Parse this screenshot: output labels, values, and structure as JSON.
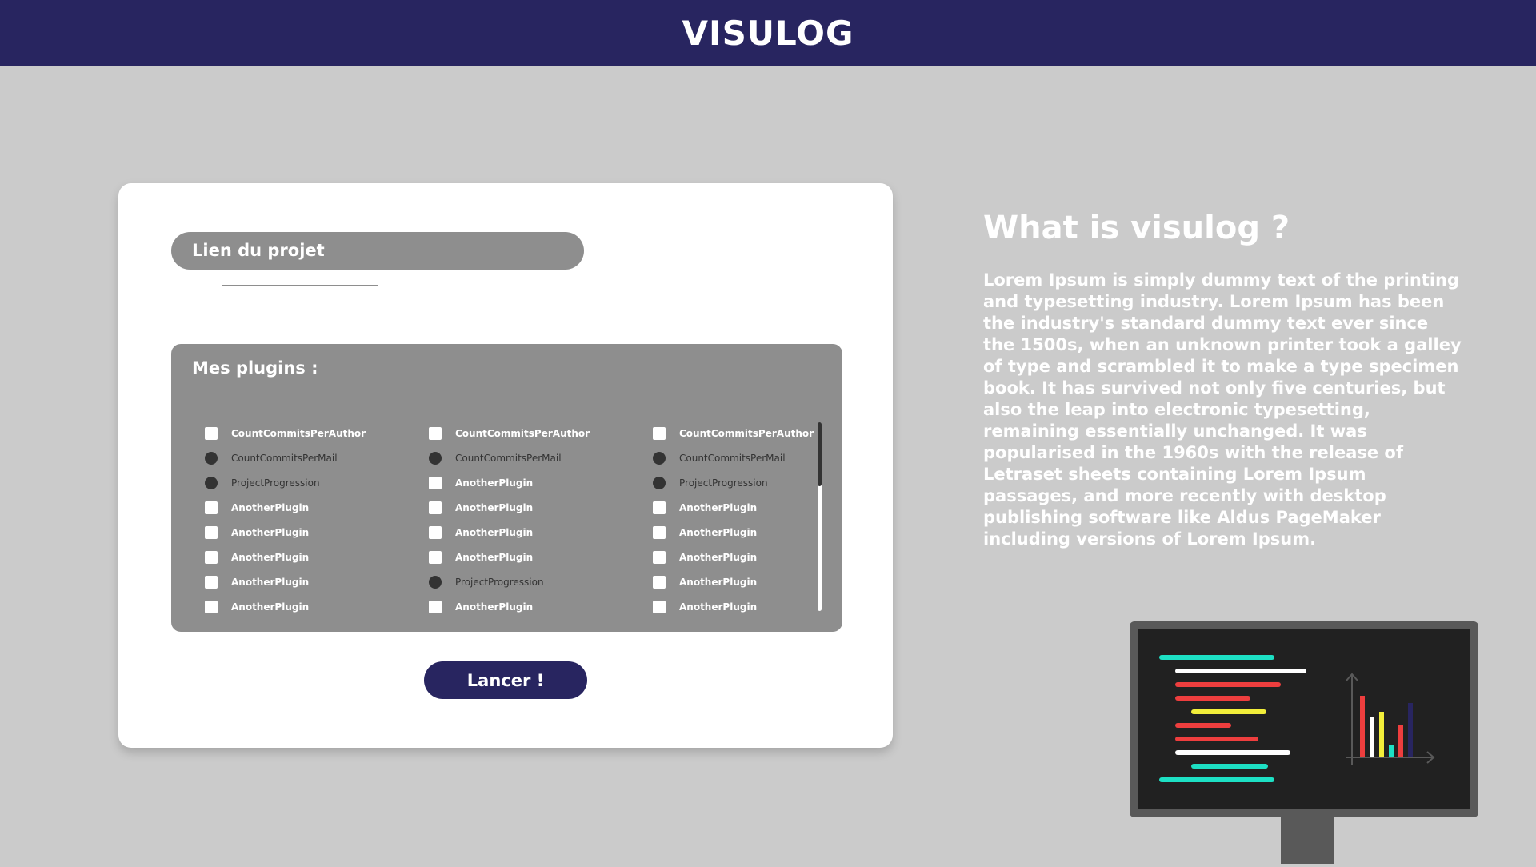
{
  "header": {
    "title": "VISULOG"
  },
  "form": {
    "link_label": "Lien du projet",
    "link_value": "",
    "plugins_title": "Mes plugins :",
    "launch_label": "Lancer !",
    "plugins": [
      [
        {
          "label": "CountCommitsPerAuthor",
          "control": "checkbox"
        },
        {
          "label": "CountCommitsPerMail",
          "control": "radio"
        },
        {
          "label": "ProjectProgression",
          "control": "radio"
        },
        {
          "label": "AnotherPlugin",
          "control": "checkbox"
        },
        {
          "label": "AnotherPlugin",
          "control": "checkbox"
        },
        {
          "label": "AnotherPlugin",
          "control": "checkbox"
        },
        {
          "label": "AnotherPlugin",
          "control": "checkbox"
        },
        {
          "label": "AnotherPlugin",
          "control": "checkbox"
        }
      ],
      [
        {
          "label": "CountCommitsPerAuthor",
          "control": "checkbox"
        },
        {
          "label": "CountCommitsPerMail",
          "control": "radio"
        },
        {
          "label": "AnotherPlugin",
          "control": "checkbox"
        },
        {
          "label": "AnotherPlugin",
          "control": "checkbox"
        },
        {
          "label": "AnotherPlugin",
          "control": "checkbox"
        },
        {
          "label": "AnotherPlugin",
          "control": "checkbox"
        },
        {
          "label": "ProjectProgression",
          "control": "radio"
        },
        {
          "label": "AnotherPlugin",
          "control": "checkbox"
        }
      ],
      [
        {
          "label": "CountCommitsPerAuthor",
          "control": "checkbox"
        },
        {
          "label": "CountCommitsPerMail",
          "control": "radio"
        },
        {
          "label": "ProjectProgression",
          "control": "radio"
        },
        {
          "label": "AnotherPlugin",
          "control": "checkbox"
        },
        {
          "label": "AnotherPlugin",
          "control": "checkbox"
        },
        {
          "label": "AnotherPlugin",
          "control": "checkbox"
        },
        {
          "label": "AnotherPlugin",
          "control": "checkbox"
        },
        {
          "label": "AnotherPlugin",
          "control": "checkbox"
        }
      ]
    ]
  },
  "info": {
    "title": "What is visulog ?",
    "body": "Lorem Ipsum is simply dummy text of the printing and typesetting industry. Lorem Ipsum has been the industry's standard dummy text ever since the 1500s, when an unknown printer took a galley of type and scrambled it to make a type specimen book. It has survived not only five centuries, but also the leap into electronic typesetting, remaining essentially unchanged. It was popularised in the 1960s with the release of Letraset sheets containing Lorem Ipsum passages, and more recently with desktop publishing software like Aldus PageMaker including versions of Lorem Ipsum."
  },
  "colors": {
    "header_bg": "#282560",
    "page_bg": "#cbcbcb",
    "panel_grey": "#8e8e8e",
    "accent_cyan": "#1de0c4",
    "accent_red": "#ee3e3e",
    "accent_yellow": "#f2ee3a"
  },
  "illustration": {
    "icon": "monitor-code-chart-icon"
  }
}
